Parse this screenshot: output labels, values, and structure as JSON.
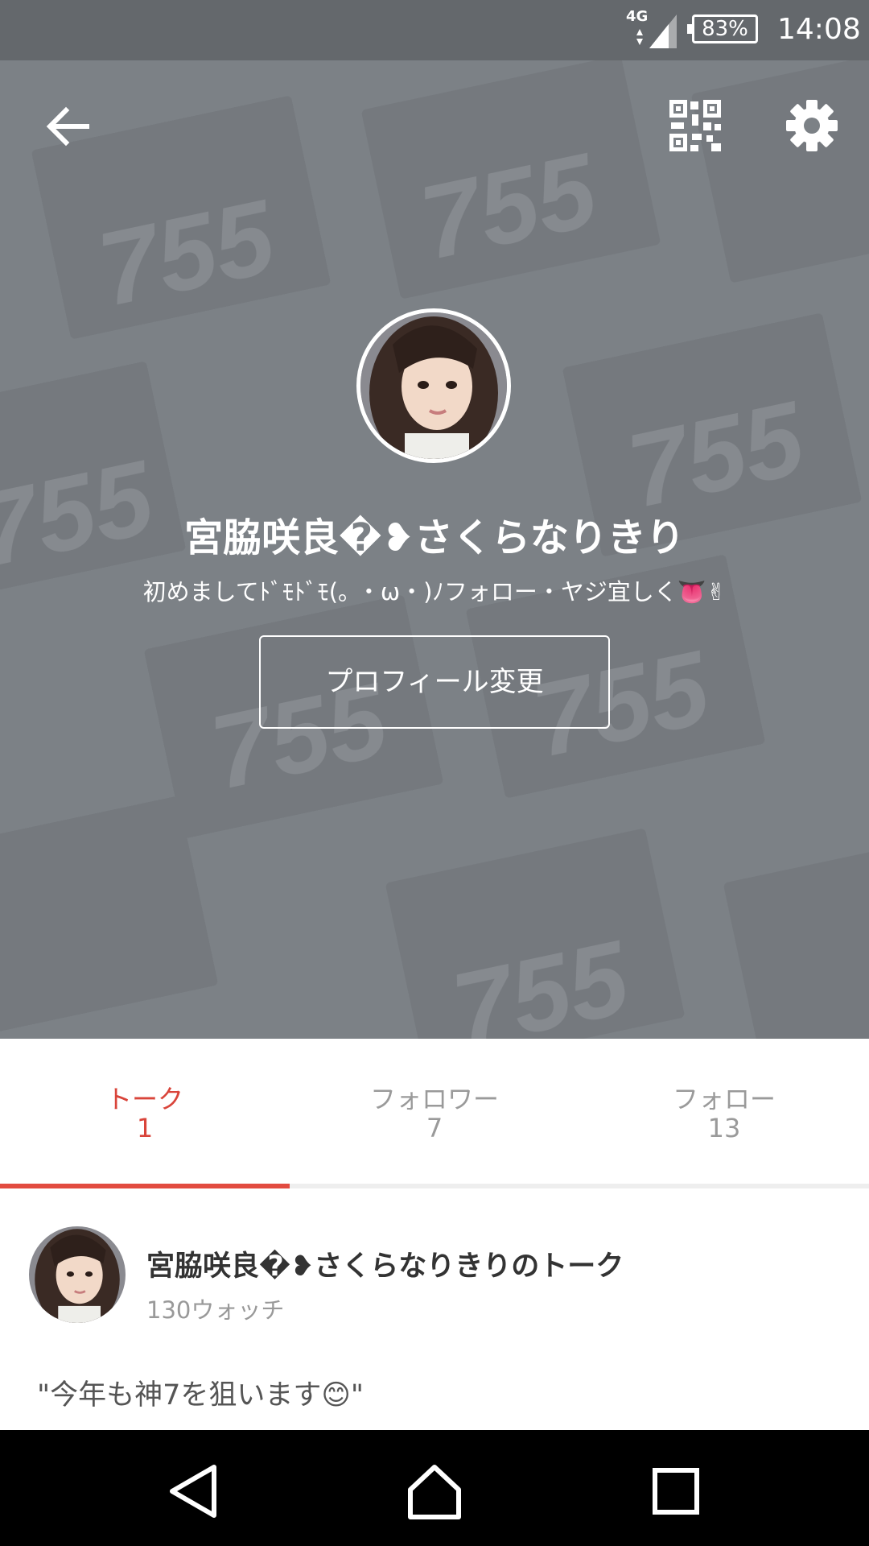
{
  "status_bar": {
    "network": "4G",
    "battery": "83%",
    "time": "14:08"
  },
  "colors": {
    "accent": "#e24b40",
    "hero_background": "#7c8186"
  },
  "icons": {
    "back": "back-arrow-icon",
    "qr": "qr-code-icon",
    "settings": "gear-icon"
  },
  "hero": {
    "watermark": "755"
  },
  "profile": {
    "name": "宮脇咲良�❥さくらなりきり",
    "bio": "初めましてﾄﾞﾓﾄﾞﾓ(｡ ・ω・)ﾉフォロー・ヤジ宜しく👅✌",
    "edit_button": "プロフィール変更"
  },
  "tabs": [
    {
      "label": "トーク",
      "count": "1"
    },
    {
      "label": "フォロワー",
      "count": "7"
    },
    {
      "label": "フォロー",
      "count": "13"
    }
  ],
  "talk": {
    "title": "宮脇咲良�❥さくらなりきりのトーク",
    "watch_count": "130ウォッチ",
    "quote": "\"今年も神7を狙います😊\""
  }
}
